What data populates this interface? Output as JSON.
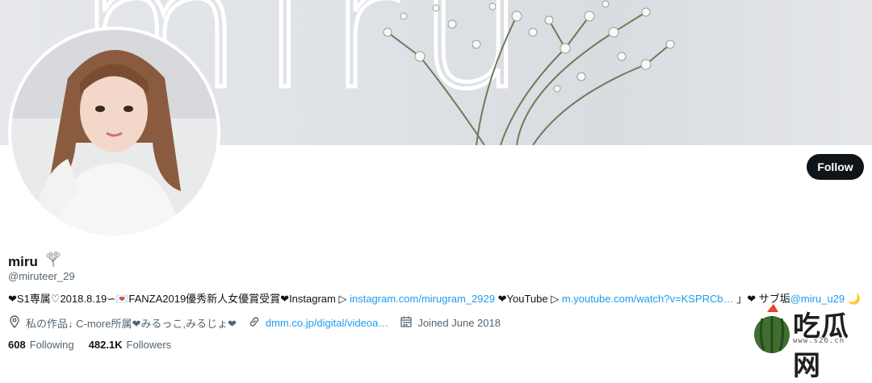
{
  "banner": {
    "text": "miru"
  },
  "profile": {
    "display_name": "miru",
    "handle": "@miruteer_29",
    "follow_label": "Follow"
  },
  "bio": {
    "part1": "❤S1専属♡2018.8.19∽💌FANZA2019優秀新人女優賞受賞❤Instagram ▷ ",
    "instagram_link": "instagram.com/mirugram_2929",
    "part2": " ❤YouTube ▷ ",
    "youtube_link": "m.youtube.com/watch?v=KSPRCb…",
    "part3": " 」❤ サブ垢",
    "sub_link": "@miru_u29",
    "part4": " 🌙"
  },
  "meta": {
    "location": "私の作品↓ C-more所属❤みるっこ,みるじょ❤",
    "website": "dmm.co.jp/digital/videoa…",
    "joined": "Joined June 2018"
  },
  "stats": {
    "following_count": "608",
    "following_label": "Following",
    "followers_count": "482.1K",
    "followers_label": "Followers"
  },
  "watermark": {
    "text": "吃瓜网",
    "url": "www.s26.cn"
  },
  "colors": {
    "link": "#1d9bf0",
    "text": "#0f1419",
    "secondary": "#536471",
    "button": "#0f1419"
  }
}
